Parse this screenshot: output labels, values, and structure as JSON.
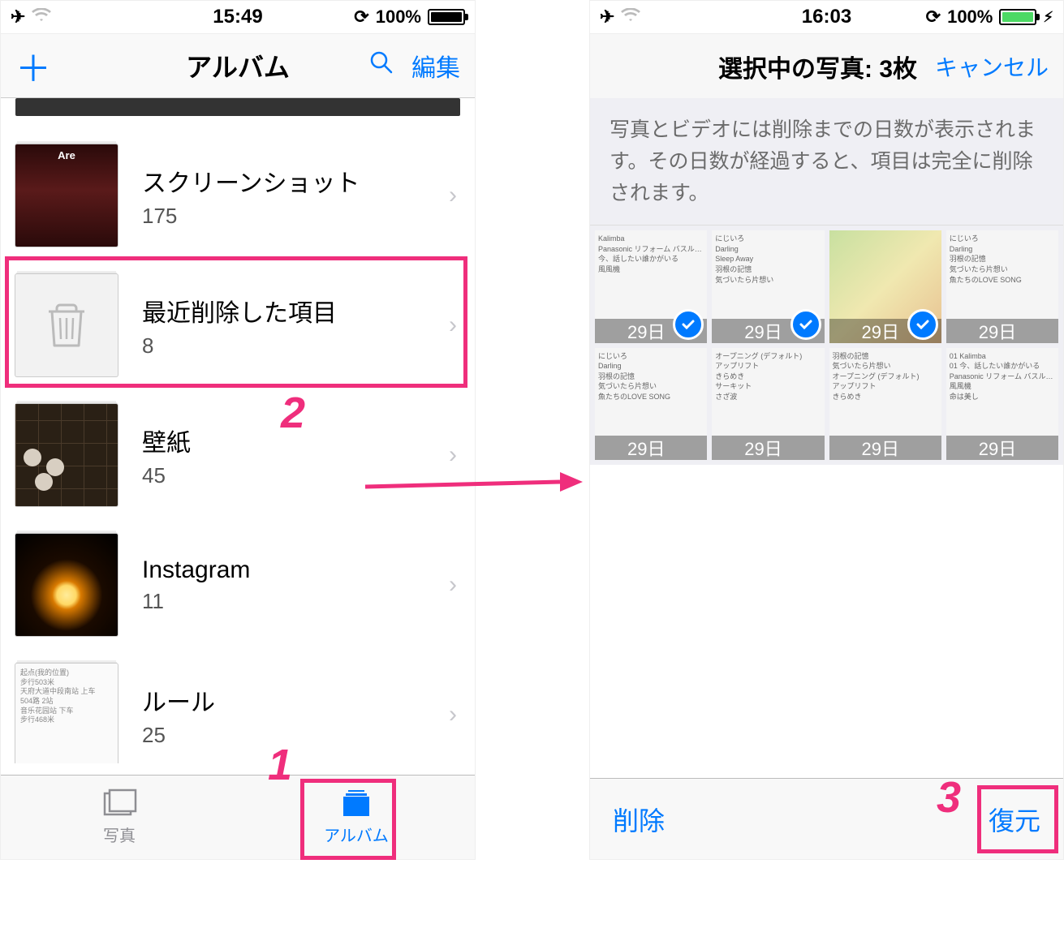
{
  "left": {
    "status": {
      "time": "15:49",
      "battery": "100%"
    },
    "nav": {
      "title": "アルバム",
      "search": "検索",
      "edit": "編集"
    },
    "albums": [
      {
        "name": "スクリーンショット",
        "count": "175"
      },
      {
        "name": "最近削除した項目",
        "count": "8"
      },
      {
        "name": "壁紙",
        "count": "45"
      },
      {
        "name": "Instagram",
        "count": "11"
      },
      {
        "name": "ルール",
        "count": "25"
      }
    ],
    "tabs": {
      "photos": "写真",
      "albums": "アルバム"
    }
  },
  "right": {
    "status": {
      "time": "16:03",
      "battery": "100%"
    },
    "nav": {
      "title": "選択中の写真: 3枚",
      "cancel": "キャンセル"
    },
    "banner": "写真とビデオには削除までの日数が表示されます。その日数が経過すると、項目は完全に削除されます。",
    "days": "29日",
    "toolbar": {
      "delete": "削除",
      "restore": "復元"
    }
  },
  "anno": {
    "n1": "1",
    "n2": "2",
    "n3": "3"
  }
}
